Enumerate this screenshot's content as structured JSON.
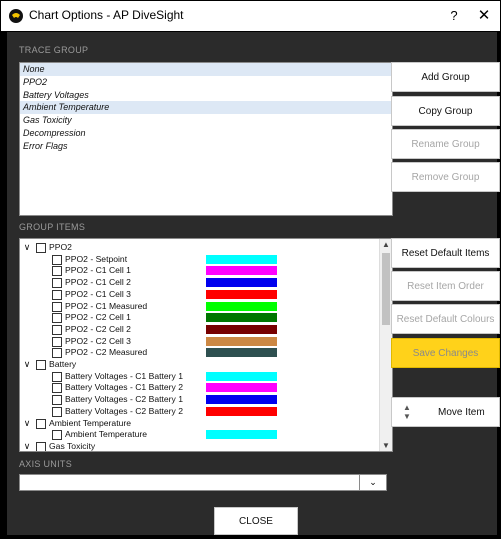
{
  "window": {
    "title": "Chart Options - AP DiveSight",
    "help_label": "?",
    "close_label": "✕"
  },
  "sections": {
    "trace_group": "TRACE GROUP",
    "group_items": "GROUP ITEMS",
    "axis_units": "AXIS UNITS"
  },
  "trace_groups": [
    {
      "label": "None",
      "selected": true
    },
    {
      "label": "PPO2",
      "selected": false
    },
    {
      "label": "Battery Voltages",
      "selected": false
    },
    {
      "label": "Ambient Temperature",
      "selected": true
    },
    {
      "label": "Gas Toxicity",
      "selected": false
    },
    {
      "label": "Decompression",
      "selected": false
    },
    {
      "label": "Error Flags",
      "selected": false
    }
  ],
  "group_buttons": {
    "add": "Add Group",
    "copy": "Copy Group",
    "rename": "Rename Group",
    "remove": "Remove Group"
  },
  "item_buttons": {
    "reset_items": "Reset Default Items",
    "reset_order": "Reset Item Order",
    "reset_colours": "Reset Default Colours",
    "save": "Save Changes",
    "move": "Move Item"
  },
  "group_items": [
    {
      "type": "group",
      "label": "PPO2",
      "chevron": "∨"
    },
    {
      "type": "item",
      "label": "PPO2 - Setpoint",
      "color": "#00ffff"
    },
    {
      "type": "item",
      "label": "PPO2 - C1 Cell 1",
      "color": "#ff00ff"
    },
    {
      "type": "item",
      "label": "PPO2 - C1 Cell 2",
      "color": "#0000ee"
    },
    {
      "type": "item",
      "label": "PPO2 - C1 Cell 3",
      "color": "#ff0000"
    },
    {
      "type": "item",
      "label": "PPO2 - C1 Measured",
      "color": "#00ff00"
    },
    {
      "type": "item",
      "label": "PPO2 - C2 Cell 1",
      "color": "#007700"
    },
    {
      "type": "item",
      "label": "PPO2 - C2 Cell 2",
      "color": "#770000"
    },
    {
      "type": "item",
      "label": "PPO2 - C2 Cell 3",
      "color": "#cc8844"
    },
    {
      "type": "item",
      "label": "PPO2 - C2 Measured",
      "color": "#2e5050"
    },
    {
      "type": "group",
      "label": "Battery",
      "chevron": "∨"
    },
    {
      "type": "item",
      "label": "Battery Voltages - C1 Battery 1",
      "color": "#00ffff"
    },
    {
      "type": "item",
      "label": "Battery Voltages - C1 Battery 2",
      "color": "#ff00ff"
    },
    {
      "type": "item",
      "label": "Battery Voltages - C2 Battery 1",
      "color": "#0000ee"
    },
    {
      "type": "item",
      "label": "Battery Voltages - C2 Battery 2",
      "color": "#ff0000"
    },
    {
      "type": "group",
      "label": "Ambient Temperature",
      "chevron": "∨"
    },
    {
      "type": "item",
      "label": "Ambient Temperature",
      "color": "#00ffff"
    },
    {
      "type": "group",
      "label": "Gas Toxicity",
      "chevron": "∨"
    }
  ],
  "axis_units": {
    "value": "",
    "dropdown_icon": "⌄"
  },
  "close_button": "CLOSE"
}
